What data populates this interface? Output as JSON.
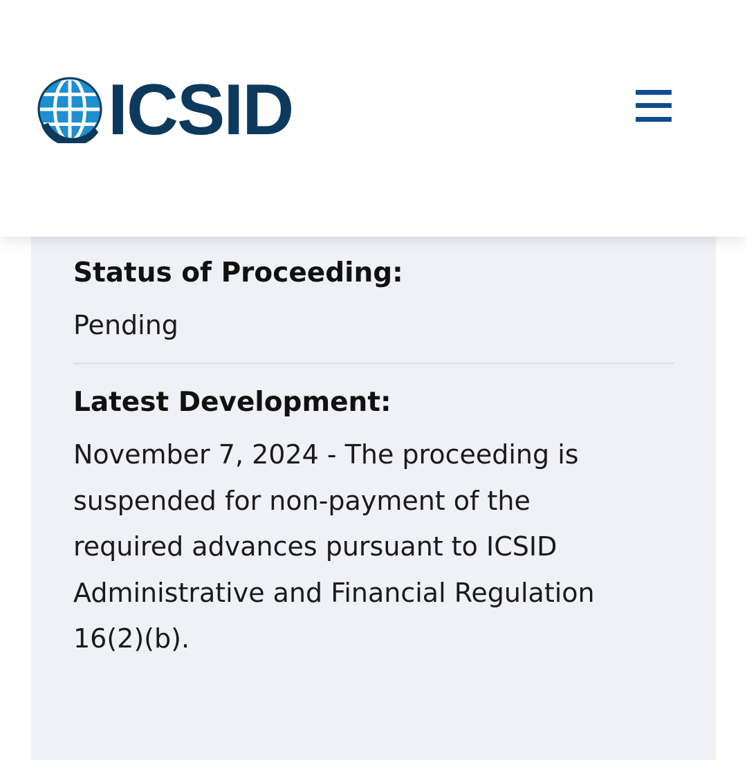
{
  "header": {
    "logo_text": "ICSID",
    "logo_icon": "globe-icon",
    "menu_icon": "hamburger-menu-icon",
    "brand_color": "#0d3a5c",
    "accent_color": "#0d4d8f"
  },
  "case": {
    "status_label": "Status of Proceeding:",
    "status_value": "Pending",
    "latest_label": "Latest Development:",
    "latest_lines": [
      "November 7, 2024 - The proceeding is",
      "suspended for non-payment of the",
      "required advances pursuant to ICSID",
      "Administrative and Financial Regulation",
      "16(2)(b)."
    ]
  }
}
